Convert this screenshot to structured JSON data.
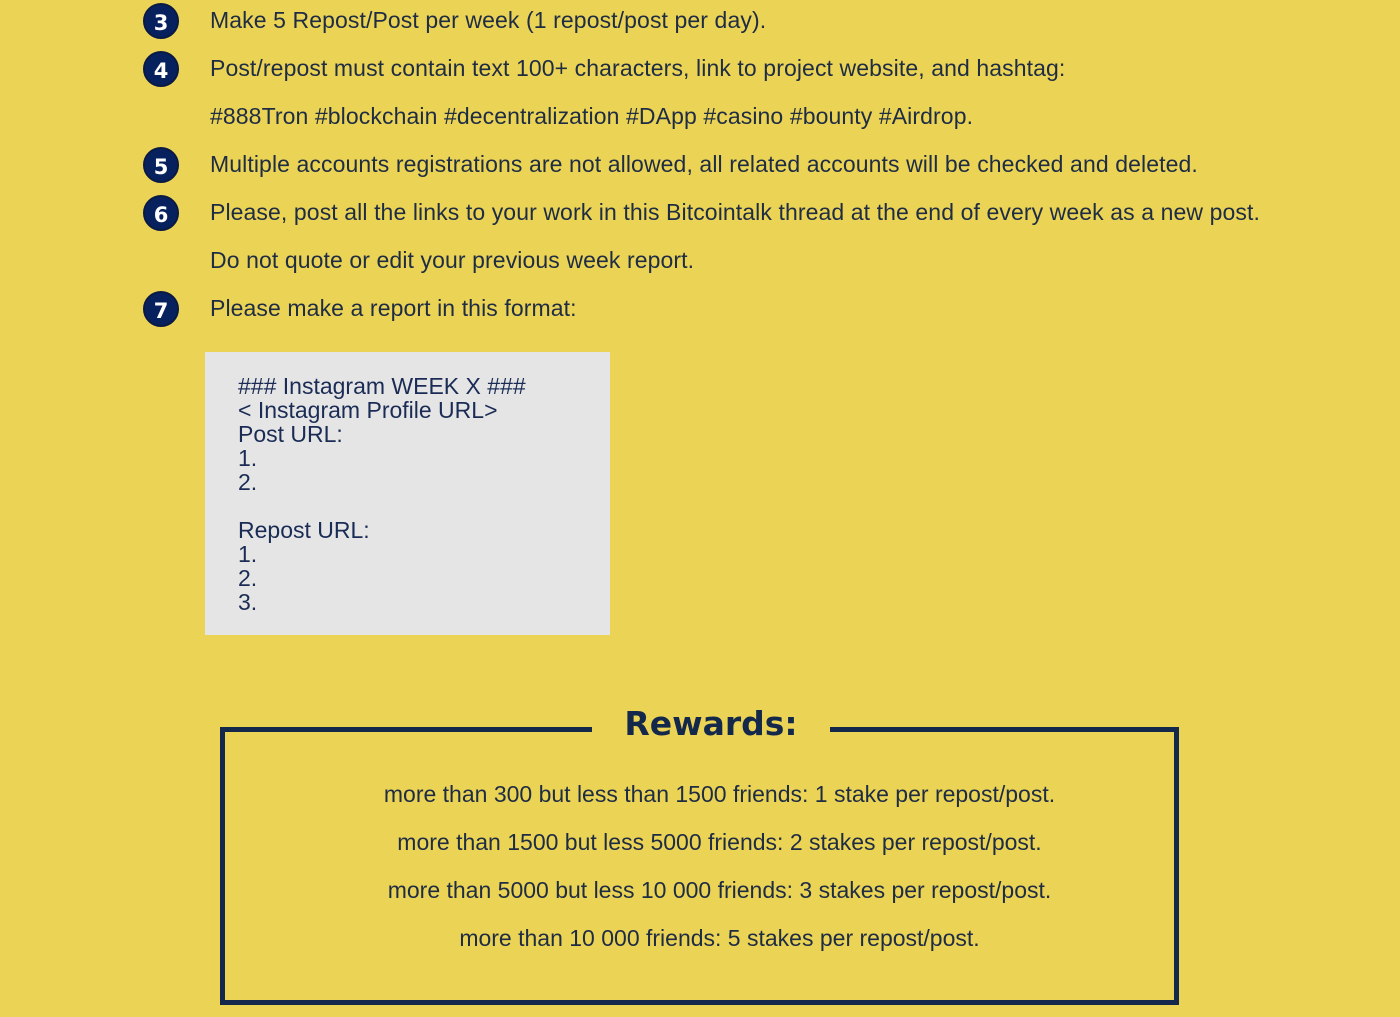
{
  "rules": [
    {
      "number": "3",
      "lines": [
        "Make 5 Repost/Post per week (1 repost/post per day)."
      ]
    },
    {
      "number": "4",
      "lines": [
        "Post/repost must contain text 100+ characters, link to project website, and hashtag:",
        "#888Tron #blockchain #decentralization #DApp #casino #bounty #Airdrop."
      ]
    },
    {
      "number": "5",
      "lines": [
        "Multiple accounts registrations are not allowed, all related accounts will be checked and deleted."
      ]
    },
    {
      "number": "6",
      "lines": [
        "Please, post all the links to your work in this Bitcointalk thread at the end of every week as a new post.",
        "Do not quote or edit your previous week report."
      ]
    },
    {
      "number": "7",
      "lines": [
        "Please make a report in this format:"
      ]
    }
  ],
  "report_format": {
    "lines": [
      "### Instagram WEEK X ###",
      "< Instagram Profile URL>",
      "Post URL:",
      "1.",
      "2.",
      "",
      "Repost URL:",
      "1.",
      "2.",
      "3."
    ]
  },
  "rewards": {
    "title": "Rewards:",
    "tiers": [
      "more than 300 but less than 1500 friends: 1 stake per repost/post.",
      "more than 1500 but less 5000 friends: 2 stakes per repost/post.",
      "more than 5000 but less 10 000 friends: 3 stakes per repost/post.",
      "more than 10 000 friends: 5 stakes per repost/post."
    ]
  },
  "colors": {
    "background": "#EBD355",
    "badge": "#07215F",
    "text": "#1E2C44",
    "code_background": "#E5E5E5",
    "frame": "#13284A"
  }
}
